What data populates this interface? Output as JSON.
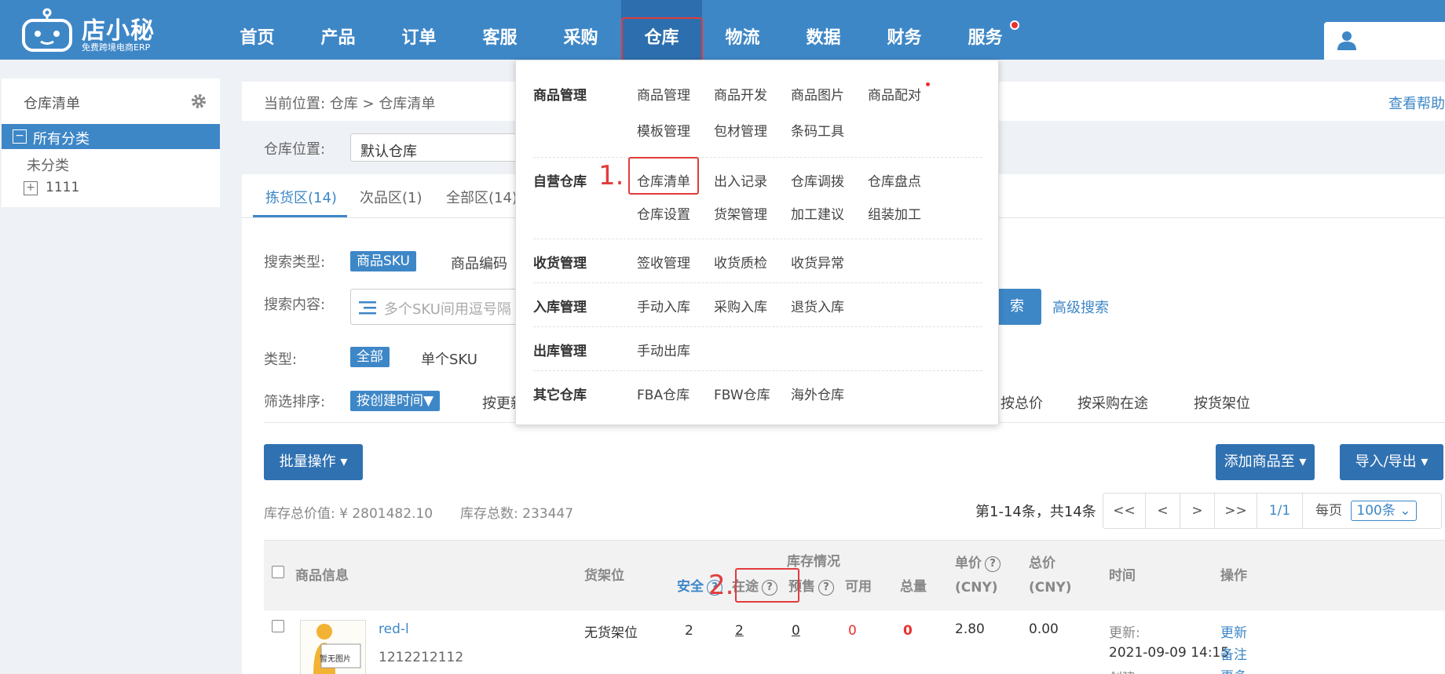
{
  "header": {
    "logo_name": "店小秘",
    "logo_sub": "免费跨境电商ERP",
    "nav": [
      "首页",
      "产品",
      "订单",
      "客服",
      "采购",
      "仓库",
      "物流",
      "数据",
      "财务",
      "服务"
    ],
    "active_nav": "仓库"
  },
  "sidebar": {
    "title": "仓库清单",
    "items": [
      {
        "label": "所有分类",
        "expand": "−"
      },
      {
        "label": "未分类"
      },
      {
        "label": "1111",
        "expand": "+"
      }
    ]
  },
  "breadcrumb": {
    "prefix": "当前位置:",
    "path": "仓库 > 仓库清单",
    "help": "查看帮助"
  },
  "warehouse": {
    "label": "仓库位置:",
    "value": "默认仓库"
  },
  "tabs": [
    "拣货区(14)",
    "次品区(1)",
    "全部区(14)"
  ],
  "filters": {
    "search_type_label": "搜索类型:",
    "search_type_active": "商品SKU",
    "search_type_opt": "商品编码",
    "search_content_label": "搜索内容:",
    "search_placeholder": "多个SKU间用逗号隔",
    "search_button": "索",
    "advanced_search": "高级搜索",
    "type_label": "类型:",
    "type_active": "全部",
    "type_opt": "单个SKU",
    "sort_label": "筛选排序:",
    "sort_active": "按创建时间▼",
    "sort_opts": [
      "按更新",
      "按总价",
      "按采购在途",
      "按货架位"
    ]
  },
  "actions": {
    "batch": "批量操作 ▾",
    "add_to": "添加商品至 ▾",
    "import_export": "导入/导出 ▾"
  },
  "stats": {
    "total_value": "库存总价值: ¥ 2801482.10",
    "total_count": "库存总数: 233447"
  },
  "pagination": {
    "summary": "第1-14条，共14条",
    "buttons": [
      "<<",
      "<",
      ">",
      ">>",
      "1/1"
    ],
    "per_page_label": "每页",
    "per_page_value": "100条 ⌄"
  },
  "table": {
    "group_header": "库存情况",
    "headers": {
      "product": "商品信息",
      "shelf": "货架位",
      "safe": "安全",
      "transit": "在途",
      "presale": "预售",
      "available": "可用",
      "total": "总量",
      "unit_price": "单价",
      "total_price": "总价",
      "cny": "(CNY)",
      "time": "时间",
      "ops": "操作"
    },
    "rows": [
      {
        "name": "red-l",
        "code": "1212212112",
        "no_image": "暂无图片",
        "shelf": "无货架位",
        "safe": "2",
        "transit": "2",
        "presale": "0",
        "available": "0",
        "total": "0",
        "unit_price": "2.80",
        "total_price": "0.00",
        "updated_label": "更新:",
        "updated": "2021-09-09 14:15",
        "created_label": "创建:",
        "ops": [
          "更新",
          "备注",
          "更多 ⌄"
        ]
      }
    ]
  },
  "dropdown": {
    "groups": [
      {
        "title": "商品管理",
        "items": [
          "商品管理",
          "商品开发",
          "商品图片",
          "商品配对",
          "模板管理",
          "包材管理",
          "条码工具"
        ]
      },
      {
        "title": "自营仓库",
        "items": [
          "仓库清单",
          "出入记录",
          "仓库调拨",
          "仓库盘点",
          "仓库设置",
          "货架管理",
          "加工建议",
          "组装加工"
        ]
      },
      {
        "title": "收货管理",
        "items": [
          "签收管理",
          "收货质检",
          "收货异常"
        ]
      },
      {
        "title": "入库管理",
        "items": [
          "手动入库",
          "采购入库",
          "退货入库"
        ]
      },
      {
        "title": "出库管理",
        "items": [
          "手动出库"
        ]
      },
      {
        "title": "其它仓库",
        "items": [
          "FBA仓库",
          "FBW仓库",
          "海外仓库"
        ]
      }
    ]
  },
  "annotations": {
    "step1": "1.",
    "step2": "2."
  },
  "colors": {
    "primary": "#3e87c7",
    "primary_dark": "#2d6fae",
    "highlight_red": "#e23b3b",
    "value_red": "#e8312f"
  }
}
